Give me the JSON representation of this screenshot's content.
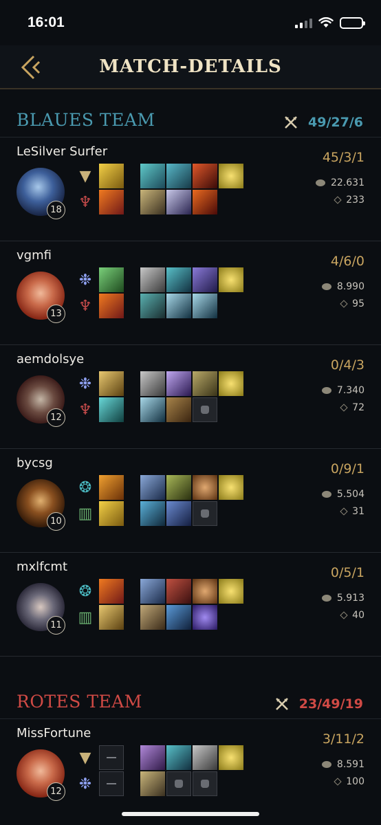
{
  "status_bar": {
    "time": "16:01"
  },
  "header": {
    "title": "MATCH-DETAILS"
  },
  "blue_team": {
    "name": "BLAUES TEAM",
    "score": "49/27/6",
    "color": "#4a9ab0",
    "players": [
      {
        "name": "LeSilver Surfer",
        "level": "18",
        "kda": "45/3/1",
        "gold": "22.631",
        "cs": "233"
      },
      {
        "name": "vgmfi",
        "level": "13",
        "kda": "4/6/0",
        "gold": "8.990",
        "cs": "95"
      },
      {
        "name": "aemdolsye",
        "level": "12",
        "kda": "0/4/3",
        "gold": "7.340",
        "cs": "72"
      },
      {
        "name": "bycsg",
        "level": "10",
        "kda": "0/9/1",
        "gold": "5.504",
        "cs": "31"
      },
      {
        "name": "mxlfcmt",
        "level": "11",
        "kda": "0/5/1",
        "gold": "5.913",
        "cs": "40"
      }
    ]
  },
  "red_team": {
    "name": "ROTES TEAM",
    "score": "23/49/19",
    "color": "#d04a45",
    "players": [
      {
        "name": "MissFortune",
        "level": "12",
        "kda": "3/11/2",
        "gold": "8.591",
        "cs": "100"
      }
    ]
  },
  "icons": [
    "back-chevron-icon",
    "crossed-swords-icon",
    "gold-coin-icon",
    "minion-cs-icon",
    "rune-icon",
    "summoner-spell-icon",
    "item-icon",
    "empty-item-slot-icon"
  ],
  "colors": {
    "gold_accent": "#c9a560",
    "background": "#0b0e12"
  }
}
